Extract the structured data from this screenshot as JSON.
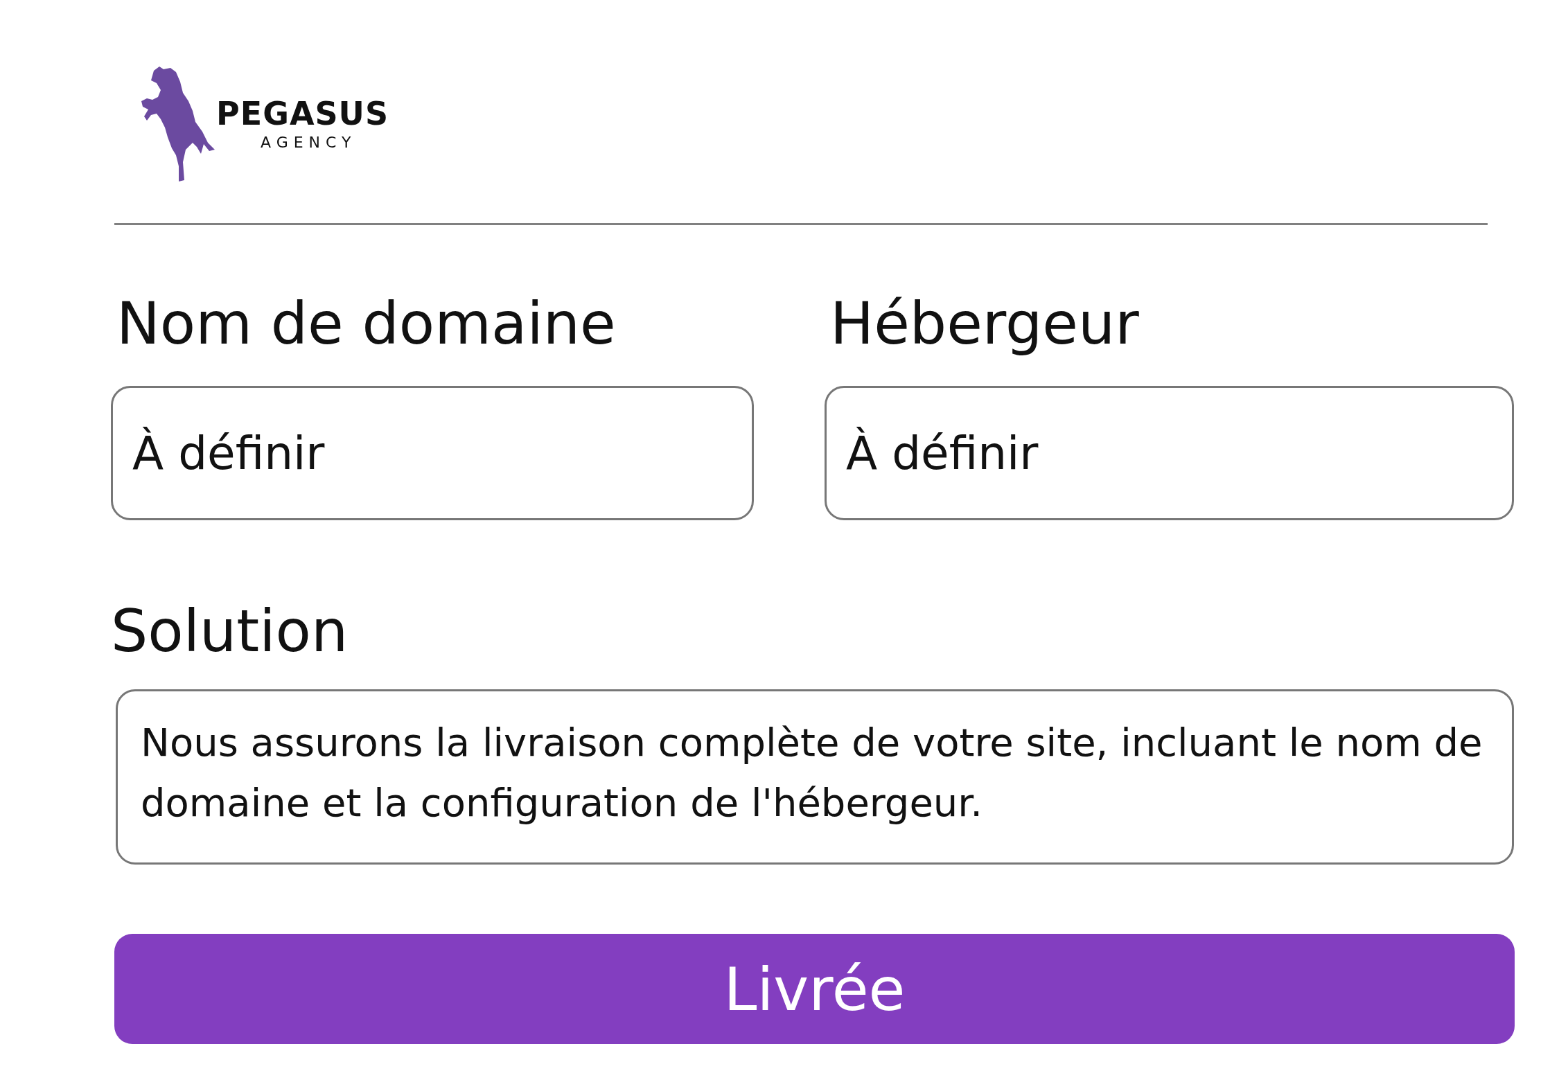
{
  "logo": {
    "name": "PEGASUS",
    "tagline": "AGENCY"
  },
  "fields": [
    {
      "label": "Nom de domaine",
      "value": "À définir"
    },
    {
      "label": "Hébergeur",
      "value": "À définir"
    }
  ],
  "solution": {
    "label": "Solution",
    "text": "Nous assurons la livraison complète de votre site, incluant le nom de domaine et la configuration de l'hébergeur."
  },
  "button": {
    "label": "Livrée"
  }
}
